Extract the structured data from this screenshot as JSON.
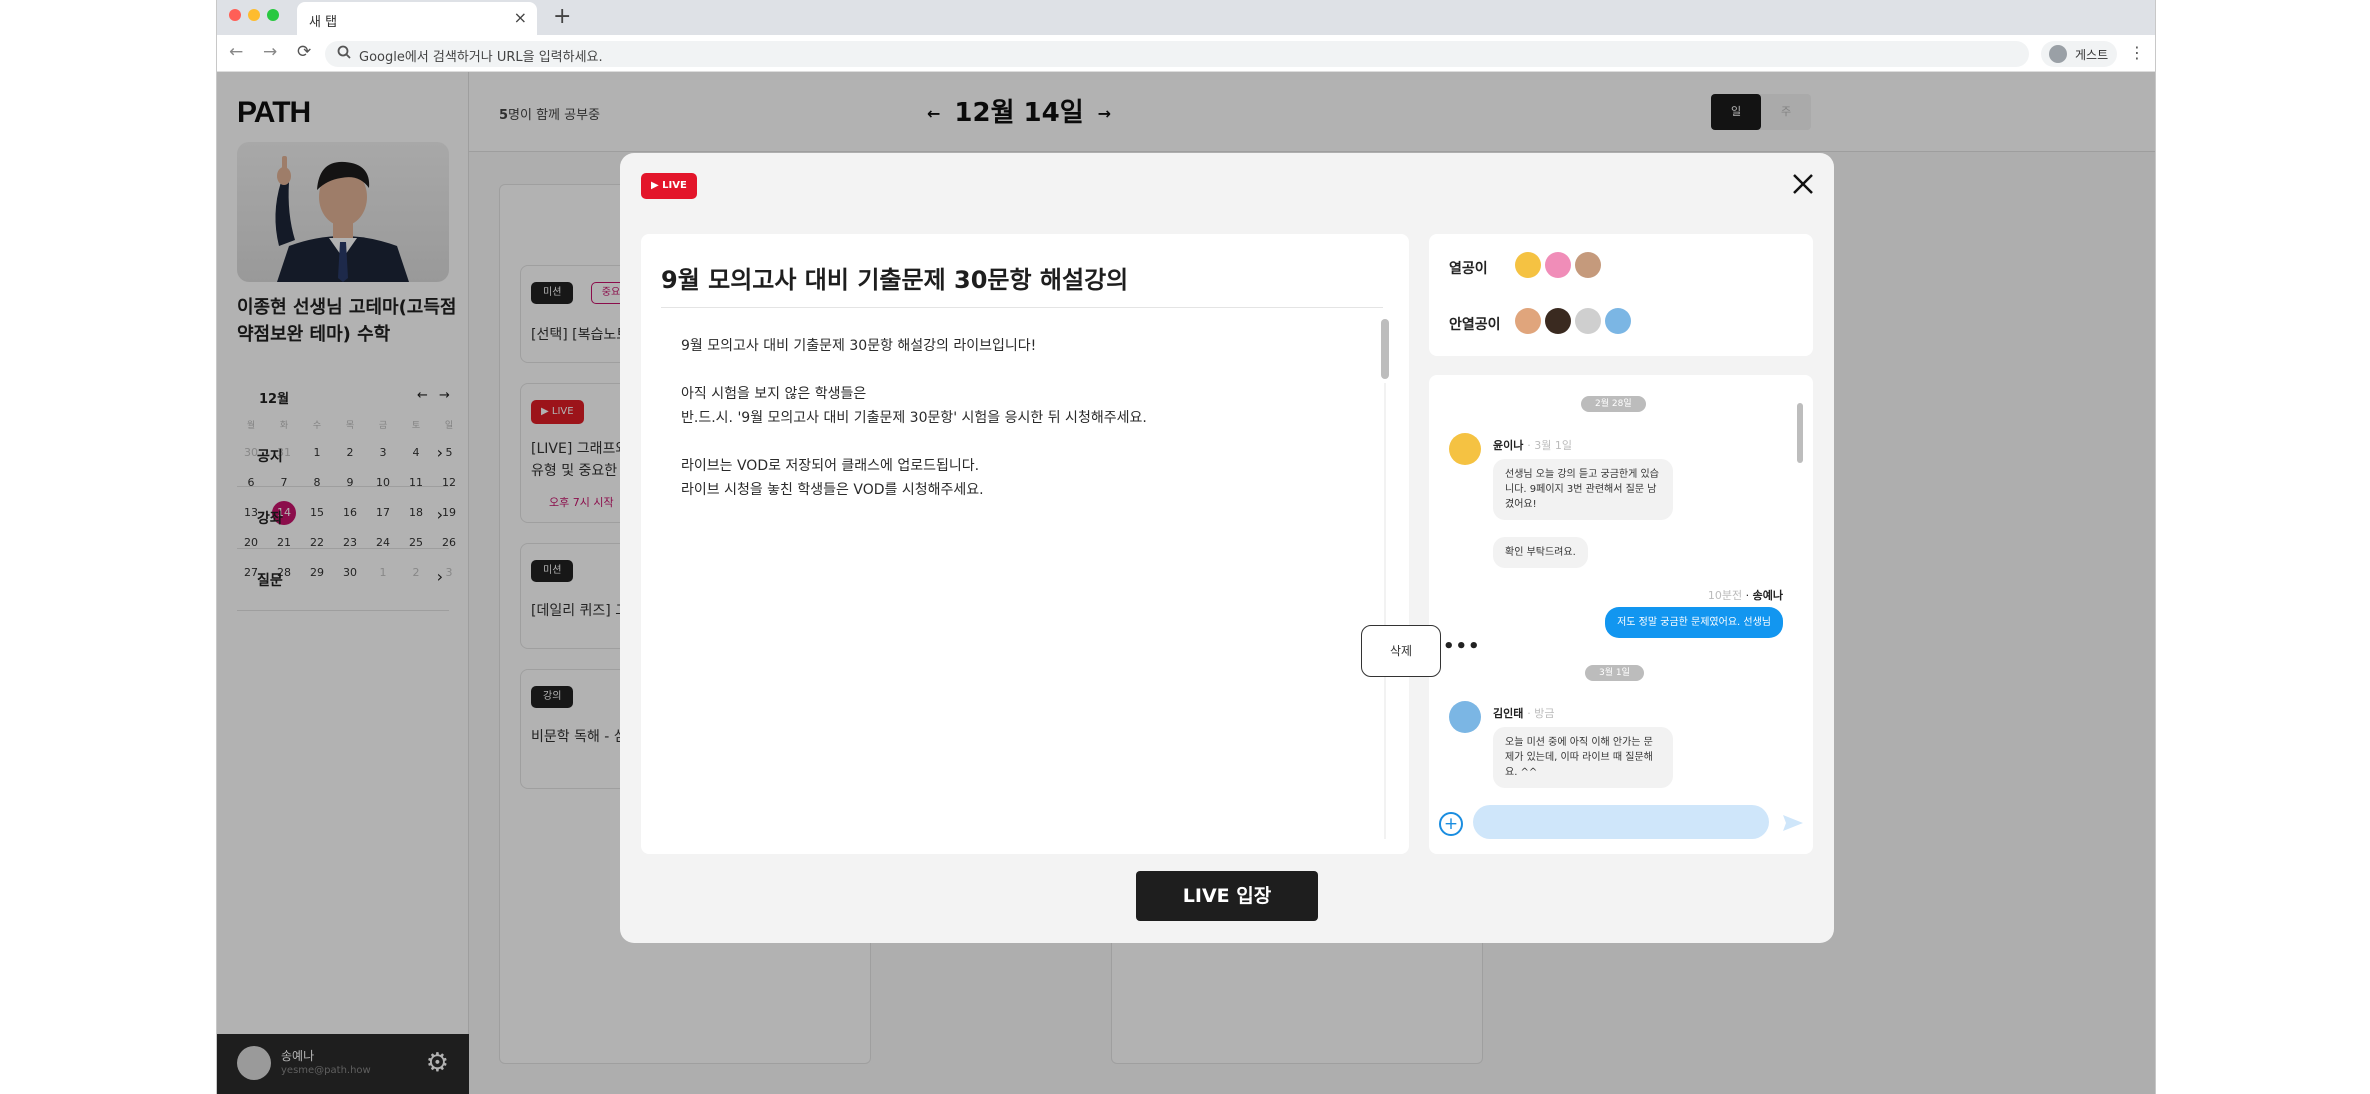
{
  "browser": {
    "tab_title": "새 탭",
    "tab_close": "×",
    "new_tab": "+",
    "omnibox_placeholder": "Google에서 검색하거나 URL을 입력하세요.",
    "profile_label": "게스트",
    "menu_glyph": "⋮",
    "back": "←",
    "forward": "→",
    "reload": "⟳"
  },
  "sidebar": {
    "logo": "PATH",
    "teacher_name": "이종현 선생님 고테마(고득점 약점보완 테마) 수학",
    "calendar": {
      "month": "12월",
      "prev": "←",
      "next": "→",
      "weekdays": [
        "월",
        "화",
        "수",
        "목",
        "금",
        "토",
        "일"
      ],
      "weeks": [
        [
          "30",
          "31",
          "1",
          "2",
          "3",
          "4",
          "5"
        ],
        [
          "6",
          "7",
          "8",
          "9",
          "10",
          "11",
          "12"
        ],
        [
          "13",
          "14",
          "15",
          "16",
          "17",
          "18",
          "19"
        ],
        [
          "20",
          "21",
          "22",
          "23",
          "24",
          "25",
          "26"
        ],
        [
          "27",
          "28",
          "29",
          "30",
          "1",
          "2",
          "3"
        ]
      ],
      "today": "14"
    },
    "menu": [
      {
        "label": "공지"
      },
      {
        "label": "강좌"
      },
      {
        "label": "질문"
      }
    ],
    "user": {
      "name": "송예나",
      "email": "yesme@path.how"
    }
  },
  "header": {
    "studying_count": "5",
    "studying_suffix": "명이 함께 공부중",
    "date": "12월 14일",
    "view_day": "일",
    "view_week": "주"
  },
  "cards": [
    {
      "tag": "미션",
      "tag2": "중요",
      "title": "[선택] [복습노트"
    },
    {
      "tag": "LIVE",
      "title": "[LIVE] 그래프와",
      "title2": "유형 및 중요한",
      "time": "오후 7시 시작"
    },
    {
      "tag": "미션",
      "title": "[데일리 퀴즈] 그"
    },
    {
      "tag": "강의",
      "title": "비문학 독해 - 심"
    }
  ],
  "modal": {
    "live_badge": "LIVE",
    "title": "9월 모의고사 대비 기출문제 30문항 해설강의",
    "body": [
      "9월 모의고사 대비 기출문제 30문항 해설강의 라이브입니다!",
      "",
      "아직 시험을 보지 않은 학생들은",
      "반.드.시. '9월 모의고사 대비 기출문제 30문항' 시험을 응시한 뒤 시청해주세요.",
      "",
      "라이브는 VOD로 저장되어 클래스에 업로드됩니다.",
      "라이브 시청을 놓친 학생들은 VOD를 시청해주세요."
    ],
    "active_label": "열공이",
    "inactive_label": "안열공이",
    "enter_button": "LIVE 입장",
    "delete_label": "삭제",
    "more_glyph": "•••"
  },
  "chat": {
    "date1": "2월 28일",
    "msg1": {
      "name": "윤이나",
      "time": "3월 1일",
      "text": "선생님 오늘 강의 듣고 궁금한게 있습니다. 9페이지 3번 관련해서 질문 남겼어요!",
      "text2": "확인 부탁드려요."
    },
    "mine": {
      "time": "10분전",
      "name": "송예나",
      "text": "저도 정말 궁금한 문제였어요. 선생님"
    },
    "date2": "3월 1일",
    "msg2": {
      "name": "김인태",
      "time": "방금",
      "text": "오늘 미션 중에 아직 이해 안가는 문제가 있는데, 이따 라이브 때 질문해요. ^^"
    },
    "plus": "+"
  },
  "colors": {
    "accent": "#c8146c",
    "live_red": "#e3152a",
    "chat_blue": "#1296f0",
    "dark": "#1e1e1e"
  }
}
